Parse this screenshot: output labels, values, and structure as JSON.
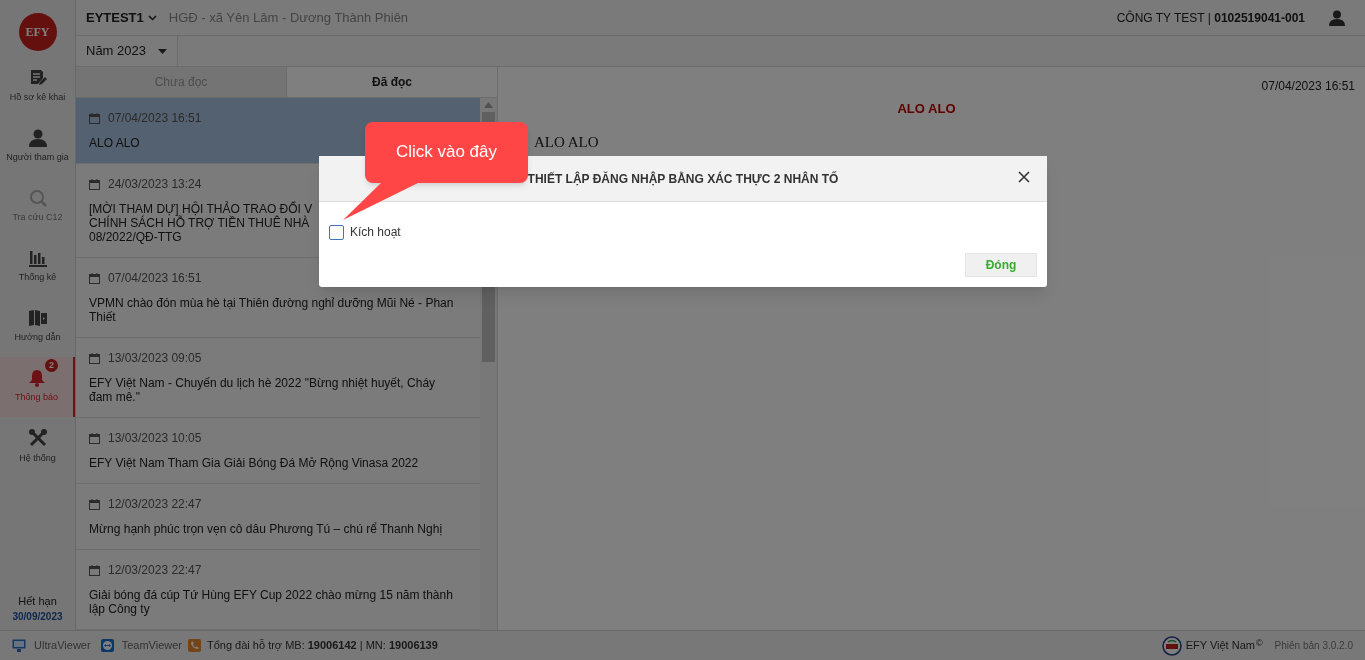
{
  "logo": {
    "text": "EFY"
  },
  "sidebar": {
    "items": [
      {
        "label": "Hồ sơ kê khai",
        "selected": false
      },
      {
        "label": "Người tham gia",
        "selected": false
      },
      {
        "label": "Tra cứu C12",
        "selected": false
      },
      {
        "label": "Thống kê",
        "selected": false
      },
      {
        "label": "Hướng dẫn",
        "selected": false
      },
      {
        "label": "Thông báo",
        "selected": true,
        "badge": "2"
      },
      {
        "label": "Hệ thống",
        "selected": false
      }
    ],
    "expiry": {
      "label": "Hết hạn",
      "date": "30/09/2023"
    }
  },
  "header": {
    "account": "EYTEST1",
    "household": "HGĐ - xã Yên Lâm - Dương Thành Phiên",
    "company": "CÔNG TY TEST | **0102519041-001**"
  },
  "year_filter": {
    "value": "Năm 2023"
  },
  "tabs": [
    {
      "label": "Chưa đọc",
      "selected": false
    },
    {
      "label": "Đã đọc",
      "selected": true
    }
  ],
  "notifications": [
    {
      "date": "07/04/2023 16:51",
      "lines": [
        "ALO ALO"
      ],
      "selected": true
    },
    {
      "date": "24/03/2023 13:24",
      "lines": [
        "[MỜI THAM DỰ] HỘI THẢO TRAO ĐỔI V",
        "CHÍNH SÁCH HỖ TRỢ TIỀN THUÊ NHÀ",
        "08/2022/QĐ-TTG"
      ],
      "selected": false
    },
    {
      "date": "07/04/2023 16:51",
      "lines": [
        "VPMN chào đón mùa hè tại Thiên đường nghỉ dưỡng Mũi Né - Phan",
        "Thiết"
      ],
      "selected": false
    },
    {
      "date": "13/03/2023 09:05",
      "lines": [
        "EFY Việt Nam - Chuyến du lịch hè 2022 \"Bừng nhiệt huyết, Cháy",
        "đam mê.\""
      ],
      "selected": false
    },
    {
      "date": "13/03/2023 10:05",
      "lines": [
        "EFY Việt Nam Tham Gia Giải Bóng Đá Mở Rộng Vinasa 2022"
      ],
      "selected": false
    },
    {
      "date": "12/03/2023 22:47",
      "lines": [
        "Mừng hạnh phúc trọn vẹn cô dâu Phương Tú – chú rể Thanh Nghị"
      ],
      "selected": false
    },
    {
      "date": "12/03/2023 22:47",
      "lines": [
        "Giải bóng đá cúp Tứ Hùng EFY Cup 2022 chào mừng 15 năm thành",
        "lập Công ty"
      ],
      "selected": false
    }
  ],
  "detail": {
    "date": "07/04/2023 16:51",
    "title": "ALO ALO",
    "body": "ALO ALO"
  },
  "dialog": {
    "title": "THIẾT LẬP ĐĂNG NHẬP BẰNG XÁC THỰC 2 NHÂN TỐ",
    "checkbox": {
      "label": "Kích hoạt",
      "checked": false
    },
    "button": "Đóng"
  },
  "callout": {
    "text": "Click vào đây"
  },
  "status_bar": {
    "tools": [
      "UltraViewer",
      "TeamViewer"
    ],
    "hotline": "Tổng đài hỗ trợ MB: **19006142** | MN: **19006139**",
    "brand": "EFY Việt Nam",
    "brand_mark": "©",
    "version": "Phiên bản 3.0.2.0"
  }
}
